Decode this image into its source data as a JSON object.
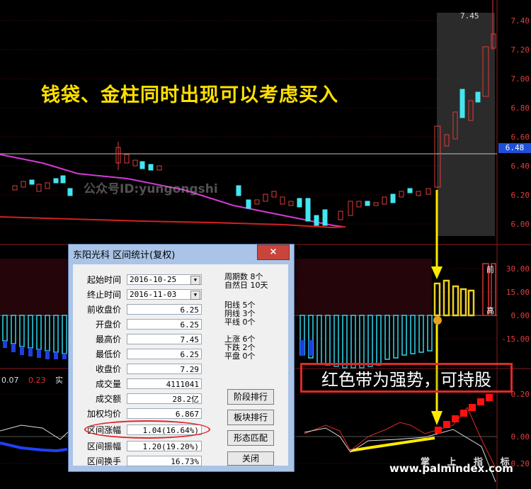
{
  "chart_data": {
    "type": "candlestick",
    "y_axis_ticks": [
      "7.40",
      "7.20",
      "7.00",
      "6.80",
      "6.60",
      "6.40",
      "6.20",
      "6.00"
    ],
    "indicator_ticks": [
      "30.00",
      "15.00",
      "0.00",
      "-15.00"
    ],
    "lower_ticks": [
      "0.20",
      "0.00",
      "-0.20"
    ],
    "current_price": "6.48",
    "top_price": "7.45"
  },
  "headline": "钱袋、金柱同时出现可以考虑买入",
  "watermark": "公众号ID:yungongshi",
  "indicator_text": {
    "a": "0.07",
    "b": "0.23",
    "c": "实"
  },
  "side_labels": {
    "top": "前",
    "bottom": "高"
  },
  "callout": "红色带为强势，可持股",
  "footer": {
    "brand": "www.palmindex.com",
    "cn": "掌 上 指 标"
  },
  "dialog": {
    "title": "东阳光科 区间统计(复权)",
    "close": "×",
    "fields": [
      {
        "label": "起始时间",
        "value": "2016-10-25",
        "type": "select"
      },
      {
        "label": "终止时间",
        "value": "2016-11-03",
        "type": "select"
      },
      {
        "label": "前收盘价",
        "value": "6.25"
      },
      {
        "label": "开盘价",
        "value": "6.25"
      },
      {
        "label": "最高价",
        "value": "7.45"
      },
      {
        "label": "最低价",
        "value": "6.25"
      },
      {
        "label": "收盘价",
        "value": "7.29"
      },
      {
        "label": "成交量",
        "value": "4111041"
      },
      {
        "label": "成交额",
        "value": "28.2亿"
      },
      {
        "label": "加权均价",
        "value": "6.867"
      },
      {
        "label": "区间涨幅",
        "value": "1.04(16.64%)"
      },
      {
        "label": "区间振幅",
        "value": "1.20(19.20%)"
      },
      {
        "label": "区间换手",
        "value": "16.73%"
      }
    ],
    "stats": [
      {
        "text": "周期数 8个"
      },
      {
        "text": "自然日 10天"
      },
      {
        "text": "阳线 5个"
      },
      {
        "text": "阴线 3个"
      },
      {
        "text": "平线 0个"
      },
      {
        "text": "上涨 6个"
      },
      {
        "text": "下跌 2个"
      },
      {
        "text": "平盘 0个"
      }
    ],
    "buttons": [
      "阶段排行",
      "板块排行",
      "形态匹配",
      "关闭"
    ]
  }
}
